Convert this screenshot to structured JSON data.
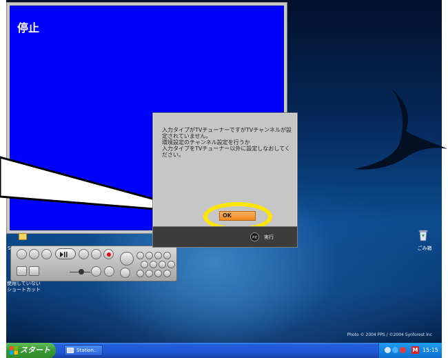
{
  "video": {
    "status_text": "停止"
  },
  "desktop": {
    "icons": {
      "player_label": "St",
      "unused_shortcut_label": "使用していない\nショートカット",
      "recycle_label": "ごみ箱"
    },
    "copyright": "Photo © 2004 PPS / ©2004 Synforest Inc"
  },
  "dialog": {
    "message": "入力タイプがTVチューナーですがTVチャンネルが設定されていません。\n環境設定のチャンネル設定を行うか\n入力タイプをTVチューナー以外に設定しなおしてください。",
    "ok_label": "OK",
    "footer": {
      "enter_icon_text": "決定",
      "execute_label": "実行"
    }
  },
  "taskbar": {
    "start_label": "スタート",
    "task_label": "Station..",
    "tray_m_label": "M",
    "clock": "15:15"
  },
  "colors": {
    "video_bg": "#0000ff",
    "ok_button": "#f59a36",
    "highlight_ring": "#ffe600"
  }
}
